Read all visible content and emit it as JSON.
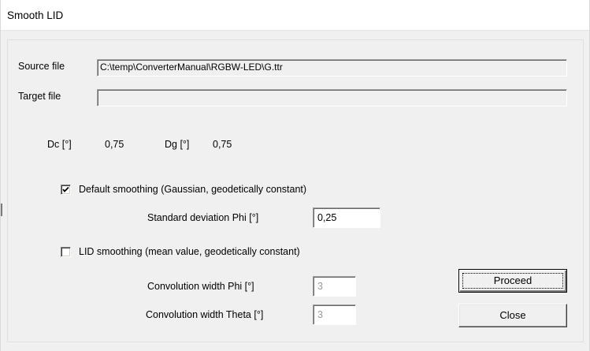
{
  "window": {
    "title": "Smooth LID"
  },
  "source": {
    "label": "Source file",
    "value": "C:\\temp\\ConverterManual\\RGBW-LED\\G.ttr"
  },
  "target": {
    "label": "Target file",
    "value": ""
  },
  "dc": {
    "label": "Dc [°]",
    "value": "0,75"
  },
  "dg": {
    "label": "Dg [°]",
    "value": "0,75"
  },
  "default_smoothing": {
    "label": "Default smoothing (Gaussian, geodetically constant)",
    "checked": true,
    "std_dev_label": "Standard deviation Phi [°]",
    "std_dev_value": "0,25"
  },
  "lid_smoothing": {
    "label": "LID smoothing (mean value, geodetically constant)",
    "checked": false,
    "conv_phi_label": "Convolution width Phi [°]",
    "conv_phi_value": "3",
    "conv_theta_label": "Convolution width Theta [°]",
    "conv_theta_value": "3"
  },
  "buttons": {
    "proceed": "Proceed",
    "close": "Close"
  }
}
